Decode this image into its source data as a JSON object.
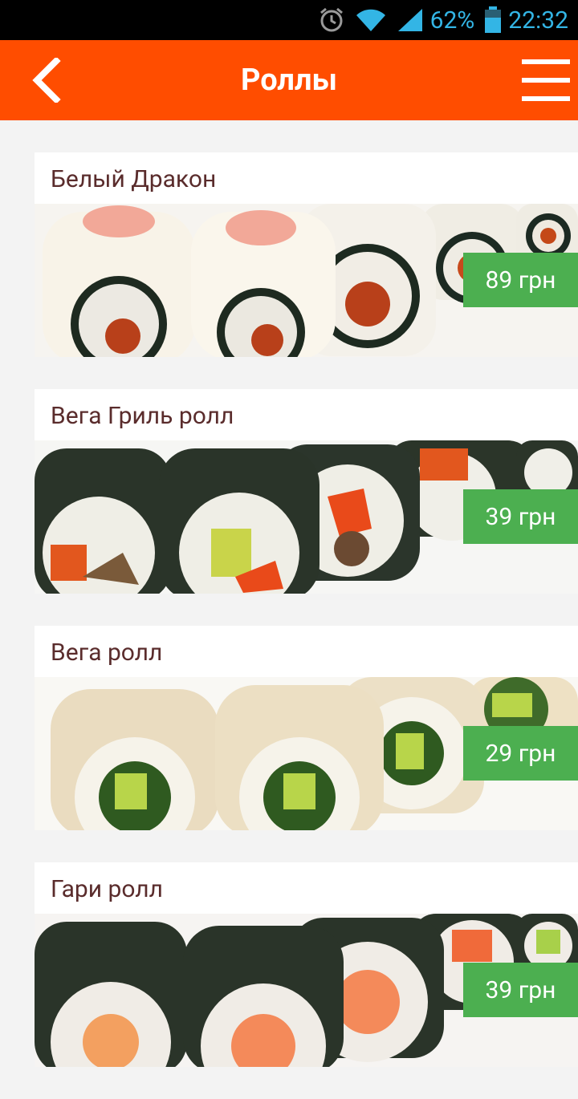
{
  "status_bar": {
    "battery_percent": "62%",
    "time": "22:32",
    "icons": [
      "alarm-icon",
      "wifi-icon",
      "signal-icon",
      "battery-icon"
    ]
  },
  "app_bar": {
    "title": "Роллы",
    "back_icon": "chevron-left-icon",
    "menu_icon": "hamburger-menu-icon",
    "color": "#ff4d00"
  },
  "products": [
    {
      "name": "Белый Дракон",
      "price": "89 грн",
      "style": "white"
    },
    {
      "name": "Вега Гриль ролл",
      "price": "39 грн",
      "style": "nori-grill"
    },
    {
      "name": "Вега ролл",
      "price": "29 грн",
      "style": "sesame"
    },
    {
      "name": "Гари ролл",
      "price": "39 грн",
      "style": "nori-salmon"
    }
  ],
  "colors": {
    "price_badge": "#4caf50",
    "name_text": "#5a2c2c"
  }
}
